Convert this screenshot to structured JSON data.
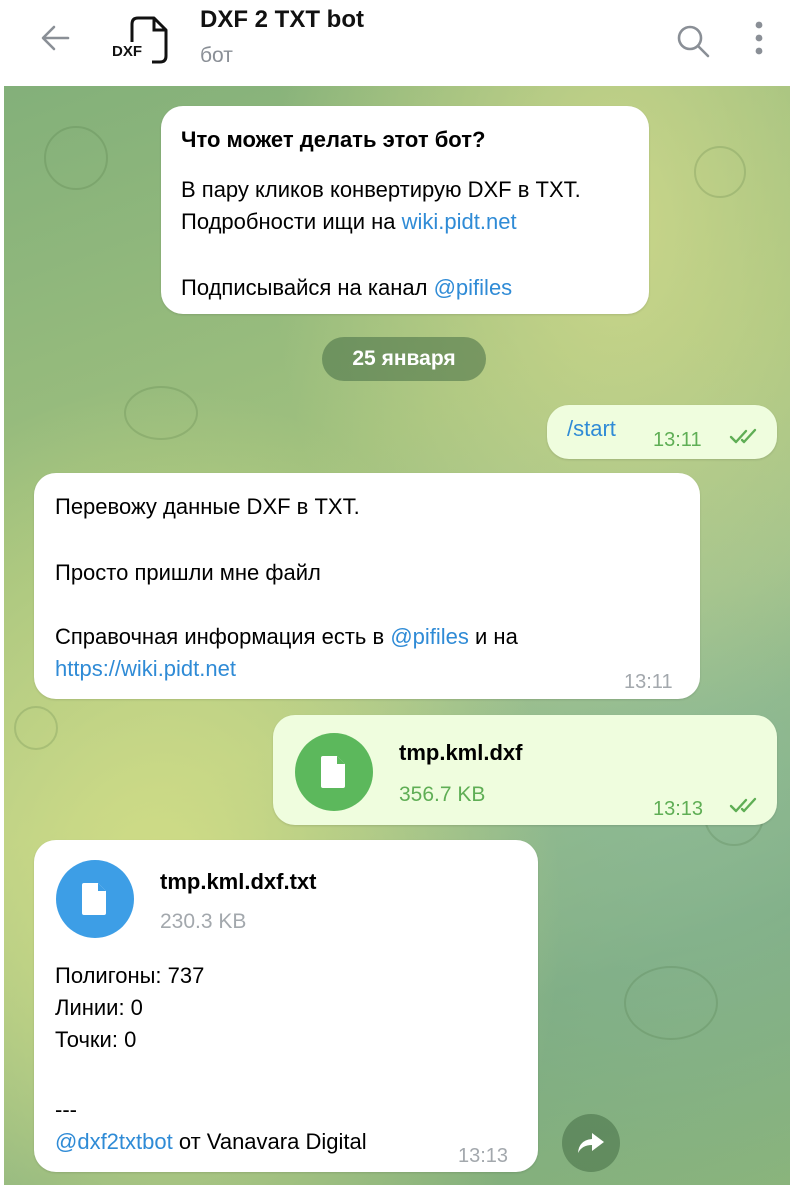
{
  "header": {
    "title": "DXF 2 TXT bot",
    "subtitle": "бот",
    "avatar_text": "DXF",
    "back_icon": "arrow-left-icon",
    "search_icon": "search-icon",
    "menu_icon": "more-vertical-icon"
  },
  "intro": {
    "heading": "Что может делать этот бот?",
    "line1": "В пару кликов конвертирую DXF в TXT.",
    "line2_prefix": "Подробности ищи на ",
    "line2_link": "wiki.pidt.net",
    "line3_prefix": "Подписывайся на канал ",
    "line3_link": "@pifiles"
  },
  "date_separator": "25 января",
  "messages": {
    "start": {
      "text": "/start",
      "time": "13:11"
    },
    "bot_reply": {
      "line1": "Перевожу данные DXF в TXT.",
      "line2": "Просто пришли мне файл",
      "line3_prefix": "Справочная информация есть в ",
      "line3_link": "@pifiles",
      "line3_suffix": " и на",
      "line4_link": "https://wiki.pidt.net",
      "time": "13:11"
    },
    "sent_file": {
      "name": "tmp.kml.dxf",
      "size": "356.7 KB",
      "time": "13:13"
    },
    "received_file": {
      "name": "tmp.kml.dxf.txt",
      "size": "230.3 KB",
      "polygons": "Полигоны: 737",
      "lines": "Линии: 0",
      "points": "Точки: 0",
      "separator": "---",
      "footer_link": "@dxf2txtbot",
      "footer_suffix": " от Vanavara Digital",
      "time": "13:13"
    }
  },
  "colors": {
    "outgoing_bubble": "#effdde",
    "incoming_bubble": "#ffffff",
    "link": "#2f8bd6",
    "sent_file_icon": "#5cb85c",
    "received_file_icon": "#3d9ee6"
  },
  "icons": {
    "file": "document-icon",
    "read": "double-check-icon",
    "forward": "forward-arrow-icon"
  }
}
